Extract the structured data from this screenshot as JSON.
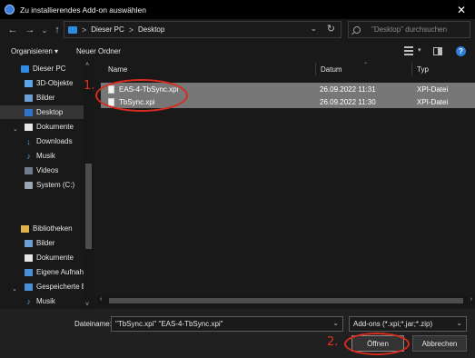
{
  "window": {
    "title": "Zu installierendes Add-on auswählen",
    "close_glyph": "✕"
  },
  "nav": {
    "back": "←",
    "forward": "→",
    "recent": "⌄",
    "up": "↑",
    "breadcrumb": [
      "Dieser PC",
      "Desktop"
    ],
    "separator": ">",
    "refresh": "↻",
    "search_placeholder": "\"Desktop\" durchsuchen"
  },
  "toolbar": {
    "organize": "Organisieren ▾",
    "new_folder": "Neuer Ordner",
    "help": "?"
  },
  "sidebar": {
    "items": [
      {
        "label": "Dieser PC",
        "icon": "pc-icon"
      },
      {
        "label": "3D-Objekte",
        "icon": "cube-icon"
      },
      {
        "label": "Bilder",
        "icon": "pictures-icon"
      },
      {
        "label": "Desktop",
        "icon": "desktop-icon",
        "selected": true
      },
      {
        "label": "Dokumente",
        "icon": "document-icon"
      },
      {
        "label": "Downloads",
        "icon": "download-icon"
      },
      {
        "label": "Musik",
        "icon": "music-icon"
      },
      {
        "label": "Videos",
        "icon": "video-icon"
      },
      {
        "label": "System (C:)",
        "icon": "drive-icon"
      },
      {
        "label": "Bibliotheken",
        "icon": "library-icon"
      },
      {
        "label": "Bilder",
        "icon": "pictures-icon"
      },
      {
        "label": "Dokumente",
        "icon": "document-icon"
      },
      {
        "label": "Eigene Aufnahm",
        "icon": "folder-icon"
      },
      {
        "label": "Gespeicherte Bi",
        "icon": "folder-icon"
      },
      {
        "label": "Musik",
        "icon": "music-icon"
      }
    ]
  },
  "columns": {
    "name": "Name",
    "date": "Datum",
    "type": "Typ"
  },
  "files": [
    {
      "name": "EAS-4-TbSync.xpi",
      "date": "26.09.2022 11:31",
      "type": "XPI-Datei"
    },
    {
      "name": "TbSync.xpi",
      "date": "26.09.2022 11:30",
      "type": "XPI-Datei"
    }
  ],
  "footer": {
    "filename_label": "Dateiname:",
    "filename_value": "\"TbSync.xpi\" \"EAS-4-TbSync.xpi\"",
    "filter_value": "Add-ons (*.xpi;*.jar;*.zip)",
    "open_label": "Öffnen",
    "cancel_label": "Abbrechen"
  },
  "annotations": {
    "step1": "1.",
    "step2": "2.",
    "color": "#d82b1d"
  }
}
